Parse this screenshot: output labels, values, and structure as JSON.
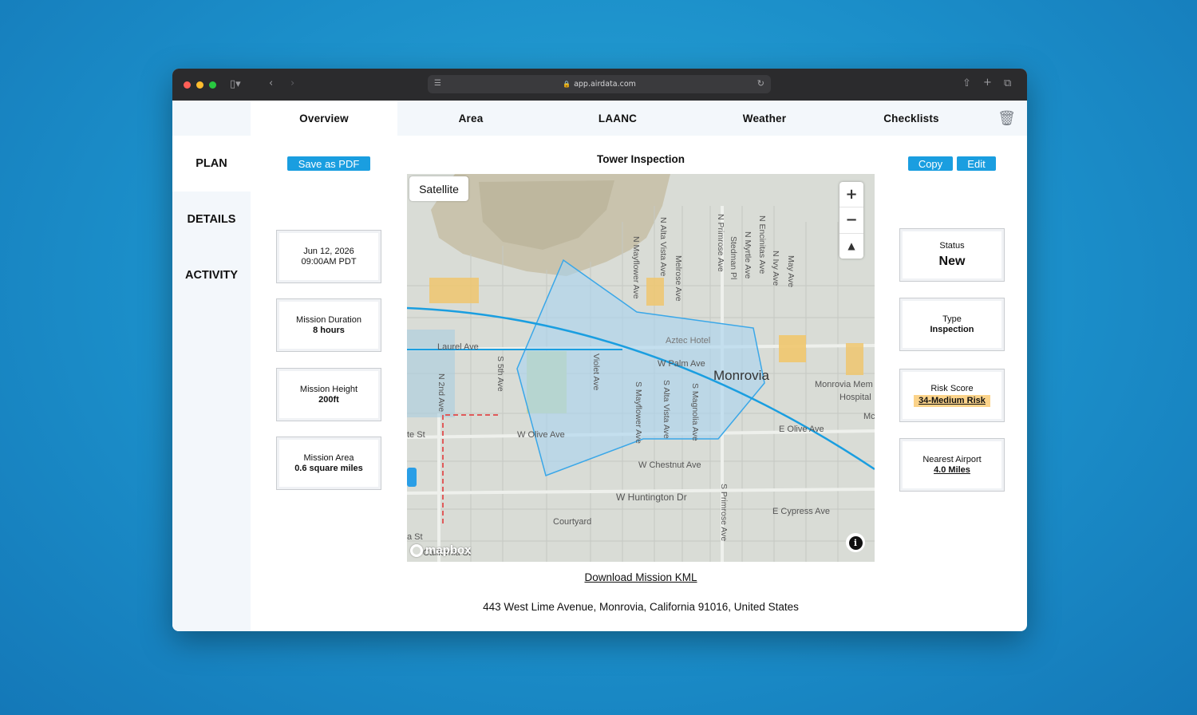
{
  "browser": {
    "url": "app.airdata.com",
    "traffic_colors": [
      "#ff5f57",
      "#febc2e",
      "#28c840"
    ]
  },
  "nav": {
    "tabs": [
      "Overview",
      "Area",
      "LAANC",
      "Weather",
      "Checklists"
    ],
    "active_tab": "Overview"
  },
  "sidebar": {
    "items": [
      "PLAN",
      "DETAILS",
      "ACTIVITY"
    ]
  },
  "actions": {
    "save_pdf": "Save as PDF",
    "copy": "Copy",
    "edit": "Edit"
  },
  "mission": {
    "title": "Tower Inspection",
    "datetime_date": "Jun 12, 2026",
    "datetime_time": "09:00AM PDT",
    "duration_label": "Mission Duration",
    "duration_value": "8 hours",
    "height_label": "Mission Height",
    "height_value": "200ft",
    "area_label": "Mission Area",
    "area_value": "0.6 square miles",
    "status_label": "Status",
    "status_value": "New",
    "type_label": "Type",
    "type_value": "Inspection",
    "risk_label": "Risk Score",
    "risk_value": "34-Medium Risk",
    "airport_label": "Nearest Airport",
    "airport_value": "4.0 Miles",
    "kml_link": "Download Mission KML",
    "address": "443 West Lime Avenue, Monrovia, California 91016, United States"
  },
  "map": {
    "satellite_label": "Satellite",
    "city_label": "Monrovia",
    "attribution": "mapbox",
    "labels": {
      "laurel": "Laurel Ave",
      "aztec": "Aztec Hotel",
      "palm": "W Palm Ave",
      "olive_w": "W Olive Ave",
      "olive_e": "E Olive Ave",
      "chestnut": "W Chestnut Ave",
      "huntington": "W Huntington Dr",
      "courtyard": "Courtyard",
      "cypress": "E Cypress Ave",
      "hospital1": "Monrovia Mem",
      "hospital2": "Hospital",
      "mc": "Mc",
      "te_st": "te St",
      "a_st": "a St",
      "california": "California St",
      "n2nd": "N 2nd Ave",
      "s5th": "S 5th Ave",
      "violet": "Violet Ave",
      "s_mayflower": "S Mayflower Ave",
      "s_alta": "S Alta Vista Ave",
      "s_magnolia": "S Magnolia Ave",
      "s_primrose": "S Primrose Ave",
      "n_mayflower": "N Mayflower Ave",
      "n_alta": "N Alta Vista Ave",
      "melrose": "Melrose Ave",
      "n_primrose": "N Primrose Ave",
      "stedman": "Stedman Pl",
      "n_myrtle": "N Myrtle Ave",
      "n_encinitas": "N Encinitas Ave",
      "n_ivy": "N Ivy Ave",
      "may": "May Ave"
    }
  },
  "colors": {
    "accent": "#1a9ee0",
    "risk_highlight": "#fbd38a",
    "polygon": "#3aa7e8"
  }
}
